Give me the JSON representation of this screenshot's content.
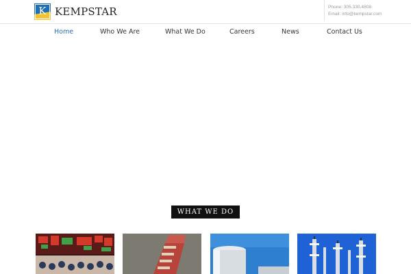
{
  "brand": {
    "name": "KEMPSTAR",
    "logo_letter": "K"
  },
  "contact": {
    "phone": "Phone: 305.330.4808",
    "email": "Email: info@kempstar.com"
  },
  "nav": {
    "items": [
      {
        "label": "Home",
        "active": true
      },
      {
        "label": "Who We Are",
        "active": false
      },
      {
        "label": "What We Do",
        "active": false
      },
      {
        "label": "Careers",
        "active": false
      },
      {
        "label": "News",
        "active": false
      },
      {
        "label": "Contact Us",
        "active": false
      }
    ]
  },
  "section": {
    "title": "WHAT WE DO"
  },
  "thumbnails": [
    {
      "subject": "trading-floor-image"
    },
    {
      "subject": "barge-image"
    },
    {
      "subject": "storage-tank-image"
    },
    {
      "subject": "refinery-image"
    }
  ],
  "colors": {
    "accent": "#2a6db5",
    "logo_blue": "#1f6fb5",
    "logo_yellow": "#f2c230"
  }
}
